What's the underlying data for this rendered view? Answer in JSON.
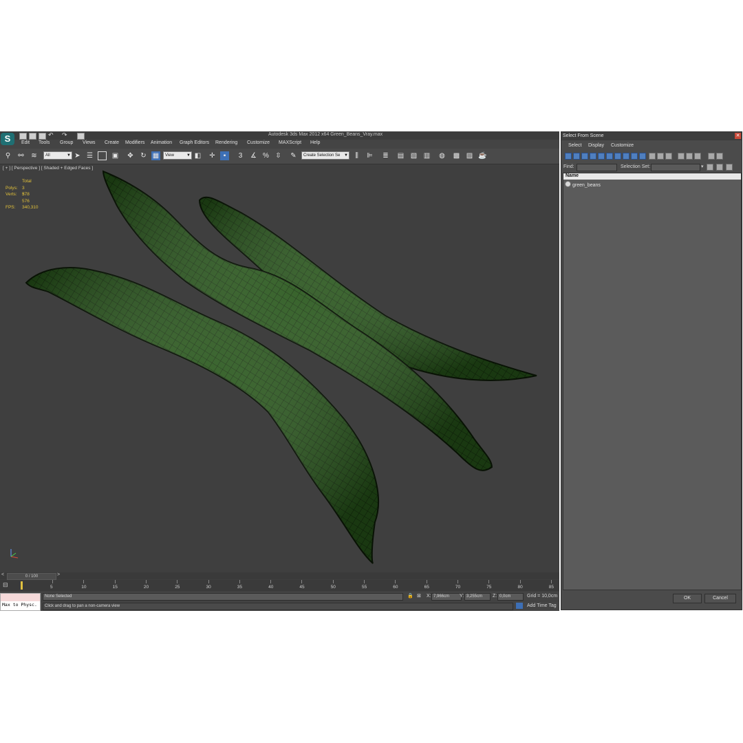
{
  "window": {
    "title": "Autodesk 3ds Max  2012 x64     Green_Beans_Vray.max"
  },
  "menu": [
    "Edit",
    "Tools",
    "Group",
    "Views",
    "Create",
    "Modifiers",
    "Animation",
    "Graph Editors",
    "Rendering",
    "Customize",
    "MAXScript",
    "Help"
  ],
  "toolbar": {
    "filter_value": "All",
    "refcoord_value": "View",
    "named_selection_value": "Create Selection Se"
  },
  "viewport": {
    "label": "[ + ] [ Perspective ] [ Shaded + Edged Faces ]",
    "stats": {
      "total_label": "Total",
      "polys_label": "Polys:",
      "polys_value": "3 578",
      "verts_label": "Verts:",
      "verts_value": "3 576",
      "fps_label": "FPS:",
      "fps_value": "340,310"
    }
  },
  "timeline": {
    "frame_display": "0 / 100",
    "ticks": [
      "5",
      "10",
      "15",
      "20",
      "25",
      "30",
      "35",
      "40",
      "45",
      "50",
      "55",
      "60",
      "65",
      "70",
      "75",
      "80",
      "85"
    ]
  },
  "status": {
    "selection": "None Selected",
    "prompt": "Click and drag to pan a non-camera view",
    "x_label": "X:",
    "x_value": "7,966cm",
    "y_label": "Y:",
    "y_value": "3,255cm",
    "z_label": "Z:",
    "z_value": "0,0cm",
    "grid": "Grid = 10,0cm",
    "add_time_tag": "Add Time Tag",
    "script_listener": "Max to Physc."
  },
  "dialog": {
    "title": "Select From Scene",
    "menu": [
      "Select",
      "Display",
      "Customize"
    ],
    "find_label": "Find:",
    "selection_set_label": "Selection Set:",
    "column_name": "Name",
    "items": [
      "green_beans"
    ],
    "ok_label": "OK",
    "cancel_label": "Cancel"
  },
  "colors": {
    "ui_dark": "#444444",
    "viewport_bg": "#3f3f3f",
    "stats_text": "#e3c23a",
    "bean_green": "#1f4a12",
    "wire": "#0a1a06",
    "selected_tool": "#4f7fbf"
  }
}
